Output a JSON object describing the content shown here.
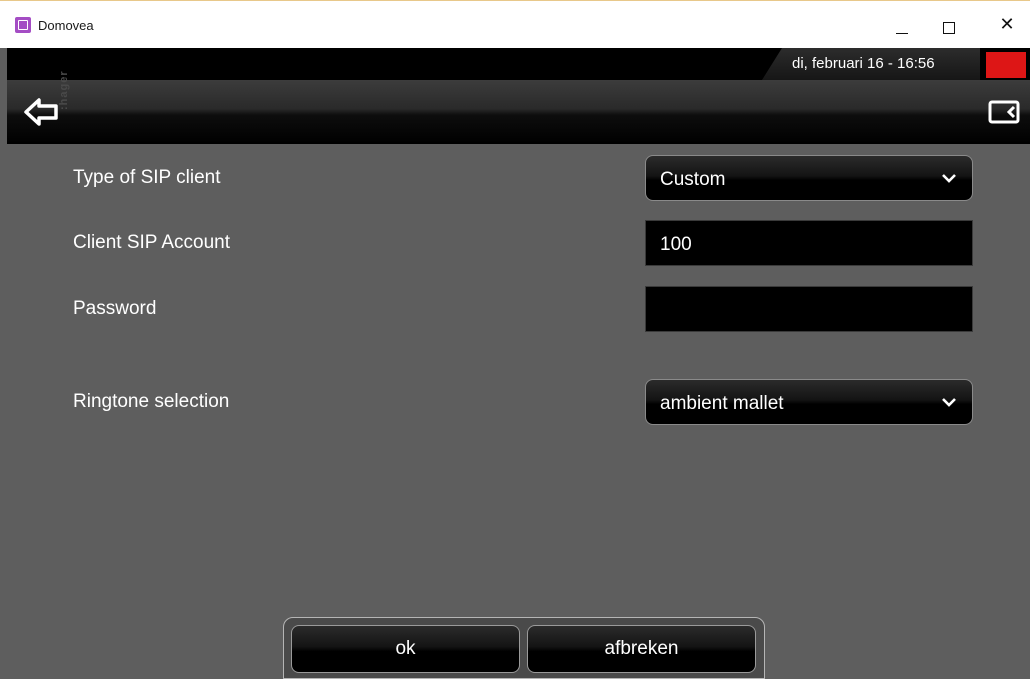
{
  "window": {
    "title": "Domovea",
    "minimize_glyph": "",
    "maximize_glyph": "",
    "close_glyph": "✕"
  },
  "status": {
    "datetime": "di, februari 16 - 16:56",
    "alarm_color": "#dd1616"
  },
  "header": {
    "brand": ":hager",
    "back_icon": "back-arrow-icon",
    "panel_icon": "panel-collapse-icon"
  },
  "form": {
    "sip_type": {
      "label": "Type of SIP client",
      "value": "Custom"
    },
    "account": {
      "label": "Client SIP Account",
      "value": "100"
    },
    "password": {
      "label": "Password",
      "value": ""
    },
    "ringtone": {
      "label": "Ringtone selection",
      "value": "ambient mallet"
    }
  },
  "actions": {
    "ok_label": "ok",
    "cancel_label": "afbreken"
  }
}
